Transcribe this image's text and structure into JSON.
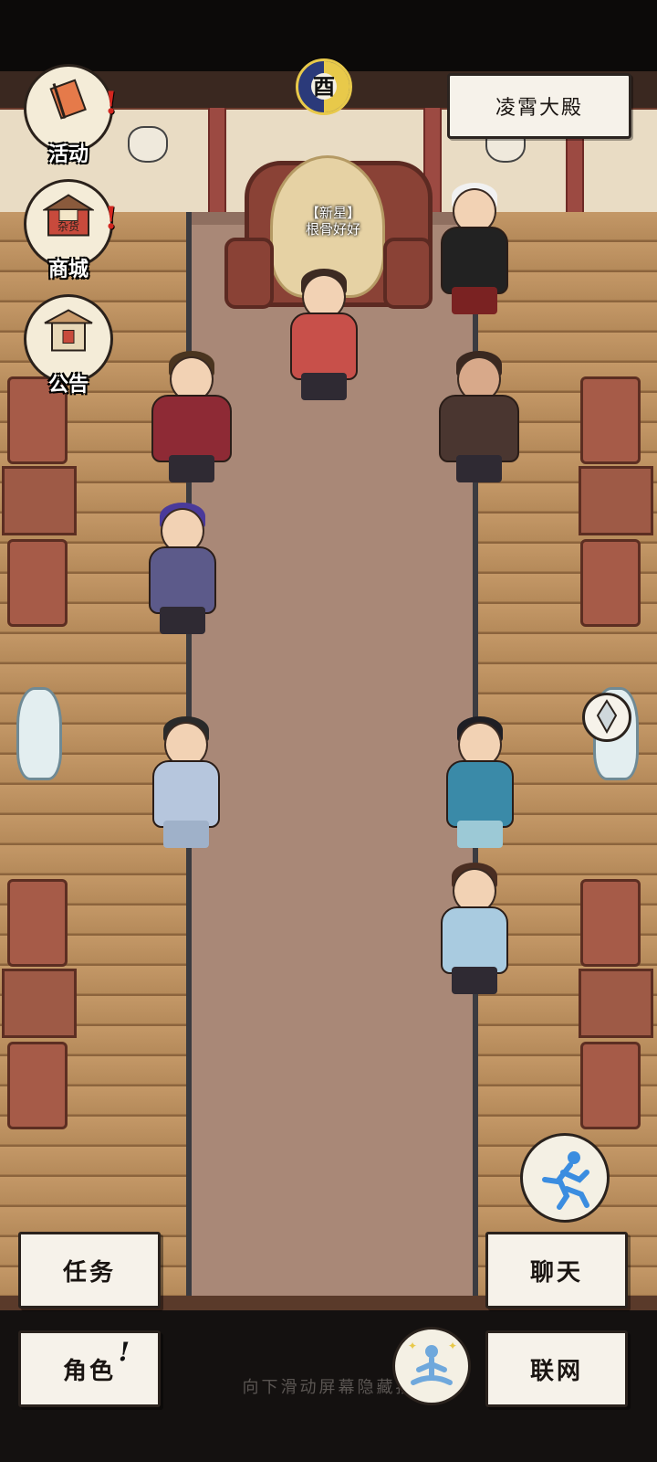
{
  "location": {
    "name": "凌霄大殿"
  },
  "clock": {
    "hour_glyph": "酉"
  },
  "player": {
    "tag_line1": "【新星】",
    "tag_line2": "根骨好好"
  },
  "menu": {
    "activity": {
      "label": "活动",
      "icon": "banner-flag-icon",
      "alert": "!"
    },
    "shop": {
      "label": "商城",
      "sign": "杂货",
      "icon": "shop-stall-icon",
      "alert": "!"
    },
    "notice": {
      "label": "公告",
      "icon": "notice-gate-icon"
    }
  },
  "buttons": {
    "quest": "任务",
    "chat": "聊天",
    "character": "角色",
    "character_alert": "!",
    "network": "联网"
  },
  "icons": {
    "sprint": "running-figure-icon",
    "meditate": "meditating-figure-icon",
    "crystal": "crystal-icon"
  },
  "hint": "向下滑动屏幕隐藏按"
}
